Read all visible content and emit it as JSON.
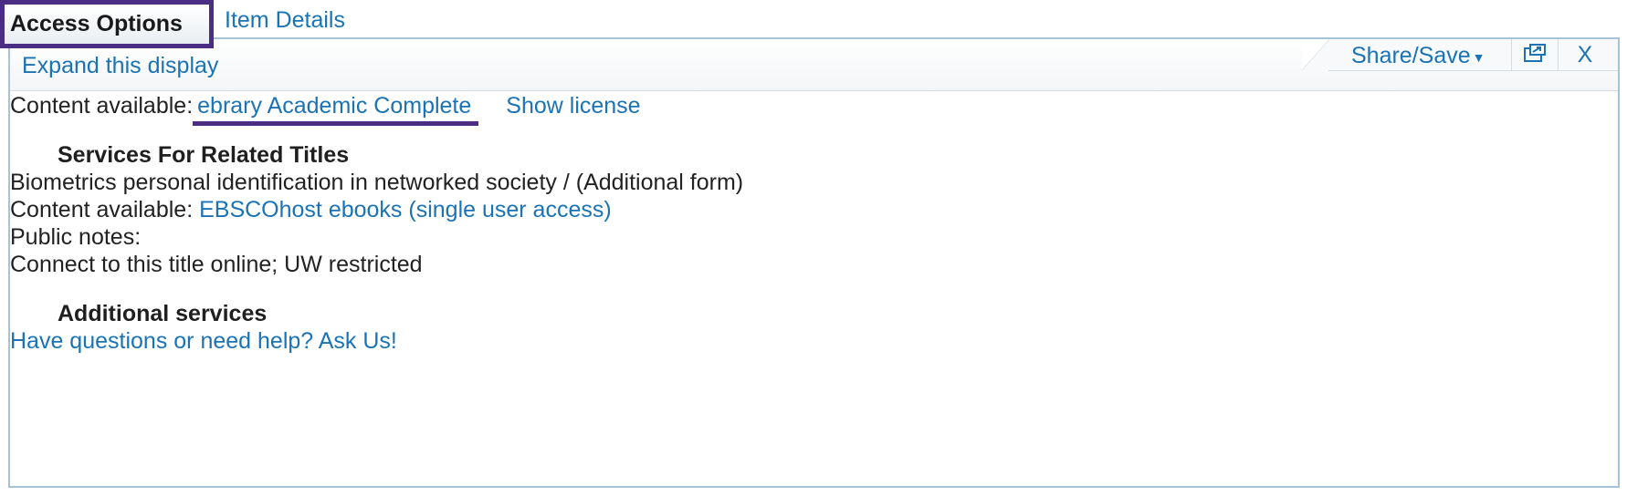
{
  "tabs": {
    "active_label": "Access Options",
    "inactive_label": "Item Details"
  },
  "panel": {
    "expand_label": "Expand this display",
    "share_save_label": "Share/Save",
    "close_label": "X"
  },
  "content": {
    "row1_prefix": "Content available:",
    "row1_link": "ebrary Academic Complete",
    "row1_license": "Show license",
    "related_heading": "Services For Related Titles",
    "related_title": "Biometrics personal identification in networked society / (Additional form)",
    "related_prefix": "Content available:",
    "related_link": "EBSCOhost ebooks (single user access)",
    "public_notes_label": "Public notes:",
    "public_notes_text": "Connect to this title online; UW restricted",
    "additional_heading": "Additional services",
    "help_link": "Have questions or need help? Ask Us!"
  },
  "colors": {
    "link": "#1a73b5",
    "highlight": "#4b2e83",
    "panel_border": "#a6c4d7"
  },
  "icons": {
    "chevron": "chevron-down-icon",
    "popout": "popout-window-icon",
    "close": "close-icon"
  }
}
